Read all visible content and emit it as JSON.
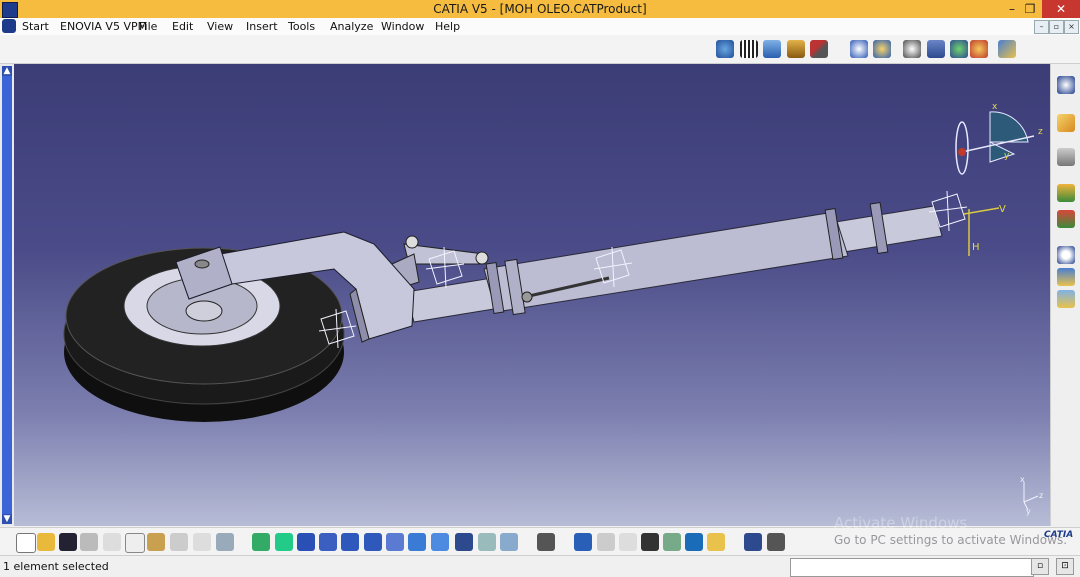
{
  "window": {
    "title": "CATIA V5 - [MOH OLEO.CATProduct]",
    "minimize": "–",
    "restore": "❐",
    "close": "✕"
  },
  "menu": {
    "items": [
      "Start",
      "ENOVIA V5 VPM",
      "File",
      "Edit",
      "View",
      "Insert",
      "Tools",
      "Analyze",
      "Window",
      "Help"
    ],
    "mdi_buttons": [
      "–",
      "▫",
      "×"
    ]
  },
  "viewport": {
    "compass_axes": [
      "x",
      "y",
      "z"
    ],
    "part_axes": [
      "V",
      "H"
    ],
    "corner_axes": [
      "x",
      "z",
      "y"
    ]
  },
  "status": {
    "text": "1 element selected",
    "command_input": ""
  },
  "watermark": {
    "line1": "Activate Windows",
    "line2": "Go to PC settings to activate Windows."
  },
  "logo": {
    "text": "CATIA"
  },
  "toolbars": {
    "top": [
      "update-all-icon",
      "catalog-icon",
      "product-icon",
      "component-icon",
      "tools-icon",
      "rotate-icon",
      "view-icon",
      "measure-icon",
      "constraint-icon",
      "analyze-icon",
      "select-icon"
    ],
    "bottom": [
      "new-icon",
      "open-icon",
      "save-icon",
      "print-icon",
      "cut-icon",
      "copy-icon",
      "paste-icon",
      "undo-icon",
      "redo-icon",
      "whats-this-icon",
      "fly-icon",
      "fit-all-icon",
      "pan-icon",
      "rotate-view-icon",
      "zoom-in-icon",
      "zoom-out-icon",
      "normal-view-icon",
      "multi-view-icon",
      "iso-view-icon",
      "shading-icon",
      "hide-show-icon",
      "swap-space-icon",
      "capture-icon",
      "target-icon",
      "prev-icon",
      "next-icon",
      "magnify-icon",
      "render-icon",
      "apply-material-icon",
      "color-icon",
      "exchange-icon",
      "layer-icon"
    ],
    "right": [
      "catia-compass-icon",
      "select-arrow-icon",
      "assembly-icon",
      "material-icon",
      "manipulate-icon",
      "spring-icon",
      "explode-icon",
      "snap-icon"
    ]
  },
  "colors": {
    "titlebar": "#f5bc3f",
    "close_button": "#c7372f",
    "viewport_top": "#3c3d77",
    "viewport_bottom": "#b7bcd6",
    "tire": "#1a1a1a",
    "part": "#c9c9dc"
  }
}
